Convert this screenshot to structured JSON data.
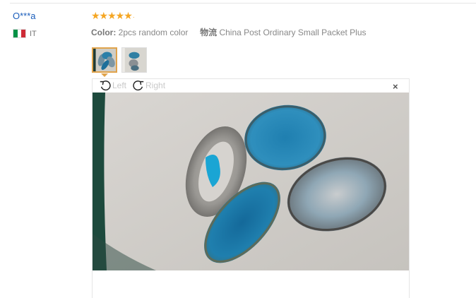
{
  "review": {
    "username": "O***a",
    "country_code": "IT",
    "rating": 5,
    "stars_text": "★★★★★",
    "stars_suffix": "·",
    "color_label": "Color:",
    "color_value": "2pcs random color",
    "logistics_label": "物流",
    "logistics_value": "China Post Ordinary Small Packet Plus"
  },
  "viewer": {
    "rotate_left_label": "Left",
    "rotate_right_label": "Right",
    "close_label": "×"
  },
  "colors": {
    "link": "#1a5dbb",
    "star": "#f5a623",
    "active_thumb_border": "#e0a34b",
    "flag_green": "#009246",
    "flag_white": "#ffffff",
    "flag_red": "#ce2b37"
  }
}
